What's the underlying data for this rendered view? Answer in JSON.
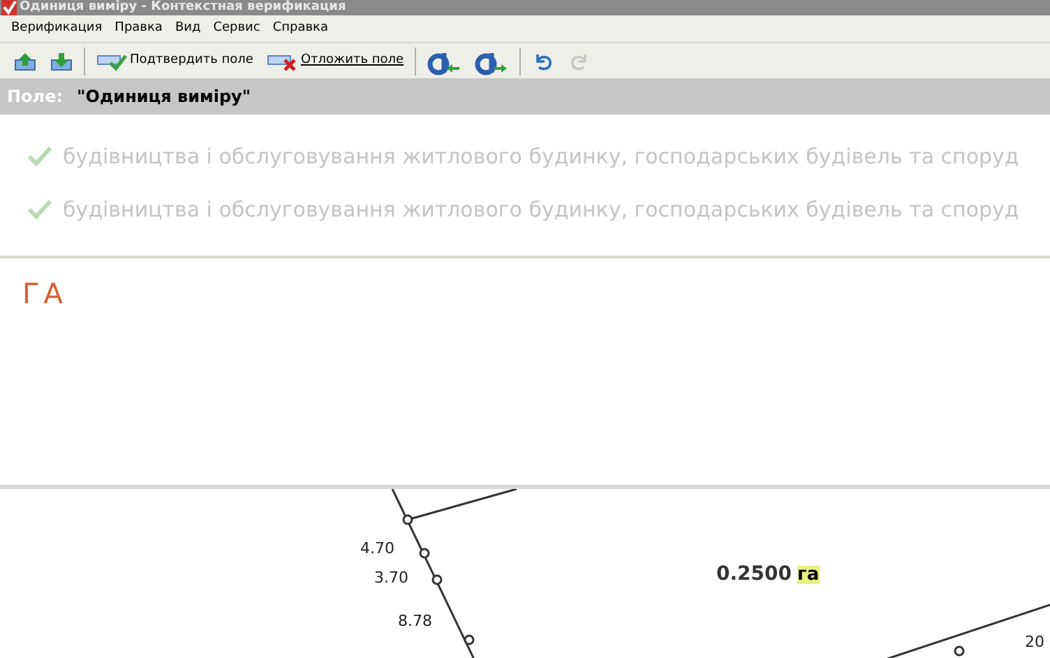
{
  "window": {
    "title": "Одиниця виміру - Контекстная верификация"
  },
  "menu": [
    "Верификация",
    "Правка",
    "Вид",
    "Сервис",
    "Справка"
  ],
  "toolbar": [
    {
      "kind": "up"
    },
    {
      "kind": "down"
    },
    {
      "kind": "confirm",
      "label": "Подтвердить поле"
    },
    {
      "kind": "postpone",
      "label": "Отложить поле"
    },
    {
      "kind": "prev"
    },
    {
      "kind": "next"
    },
    {
      "kind": "undo",
      "disabled": false
    },
    {
      "kind": "redo",
      "disabled": true
    }
  ],
  "field": {
    "label": "Поле:",
    "name": "\"Одиниця виміру\""
  },
  "suggestions": [
    {
      "text": "будівництва і обслуговування житлового будинку, господарських будівель та споруд",
      "checked": true
    },
    {
      "text": "будівництва і обслуговування житлового будинку, господарських будівель та споруд",
      "checked": true
    }
  ],
  "answer": "ГА",
  "image": {
    "labels": [
      "4.70",
      "3.70",
      "8.78",
      "20"
    ],
    "area": "0.2500",
    "unit": "га"
  }
}
